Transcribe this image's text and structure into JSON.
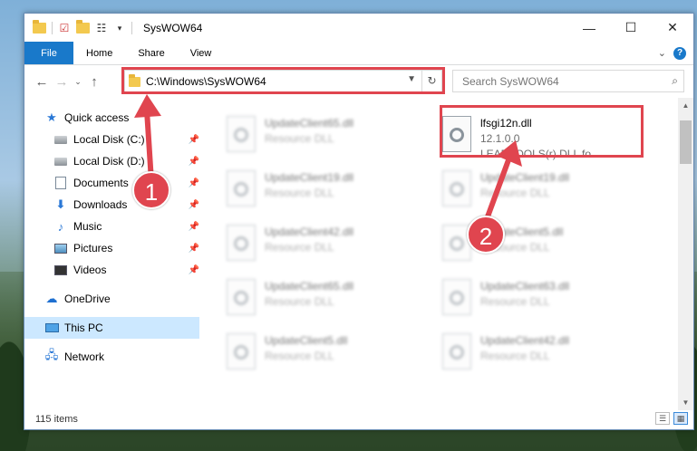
{
  "window": {
    "title": "SysWOW64",
    "minimize": "—",
    "maximize": "☐",
    "close": "✕"
  },
  "ribbon": {
    "tabs": [
      "File",
      "Home",
      "Share",
      "View"
    ]
  },
  "nav": {
    "address": "C:\\Windows\\SysWOW64",
    "search_placeholder": "Search SysWOW64"
  },
  "sidebar": {
    "quick_access": "Quick access",
    "items": [
      {
        "label": "Local Disk (C:)",
        "icon": "drive-icon"
      },
      {
        "label": "Local Disk (D:)",
        "icon": "drive-icon"
      },
      {
        "label": "Documents",
        "icon": "documents-icon"
      },
      {
        "label": "Downloads",
        "icon": "downloads-icon"
      },
      {
        "label": "Music",
        "icon": "music-icon"
      },
      {
        "label": "Pictures",
        "icon": "pictures-icon"
      },
      {
        "label": "Videos",
        "icon": "videos-icon"
      }
    ],
    "onedrive": "OneDrive",
    "this_pc": "This PC",
    "network": "Network"
  },
  "files": {
    "highlighted": {
      "name": "lfsgi12n.dll",
      "version": "12.1.0.0",
      "description": "LEADTOOLS(r) DLL fo..."
    },
    "left_column": [
      {
        "name": "UpdateClient65.dll",
        "desc": "Resource DLL"
      },
      {
        "name": "UpdateClient19.dll",
        "desc": "Resource DLL"
      },
      {
        "name": "UpdateClient42.dll",
        "desc": "Resource DLL"
      },
      {
        "name": "UpdateClient65.dll",
        "desc": "Resource DLL"
      },
      {
        "name": "UpdateClient5.dll",
        "desc": "Resource DLL"
      }
    ],
    "right_column": [
      {
        "name": "UpdateClient19.dll",
        "desc": "Resource DLL"
      },
      {
        "name": "UpdateClient5.dll",
        "desc": "Resource DLL"
      },
      {
        "name": "UpdateClient63.dll",
        "desc": "Resource DLL"
      },
      {
        "name": "UpdateClient42.dll",
        "desc": "Resource DLL"
      }
    ]
  },
  "status": {
    "item_count": "115 items"
  },
  "annotations": {
    "badge1": "1",
    "badge2": "2",
    "color": "#e0454f"
  }
}
